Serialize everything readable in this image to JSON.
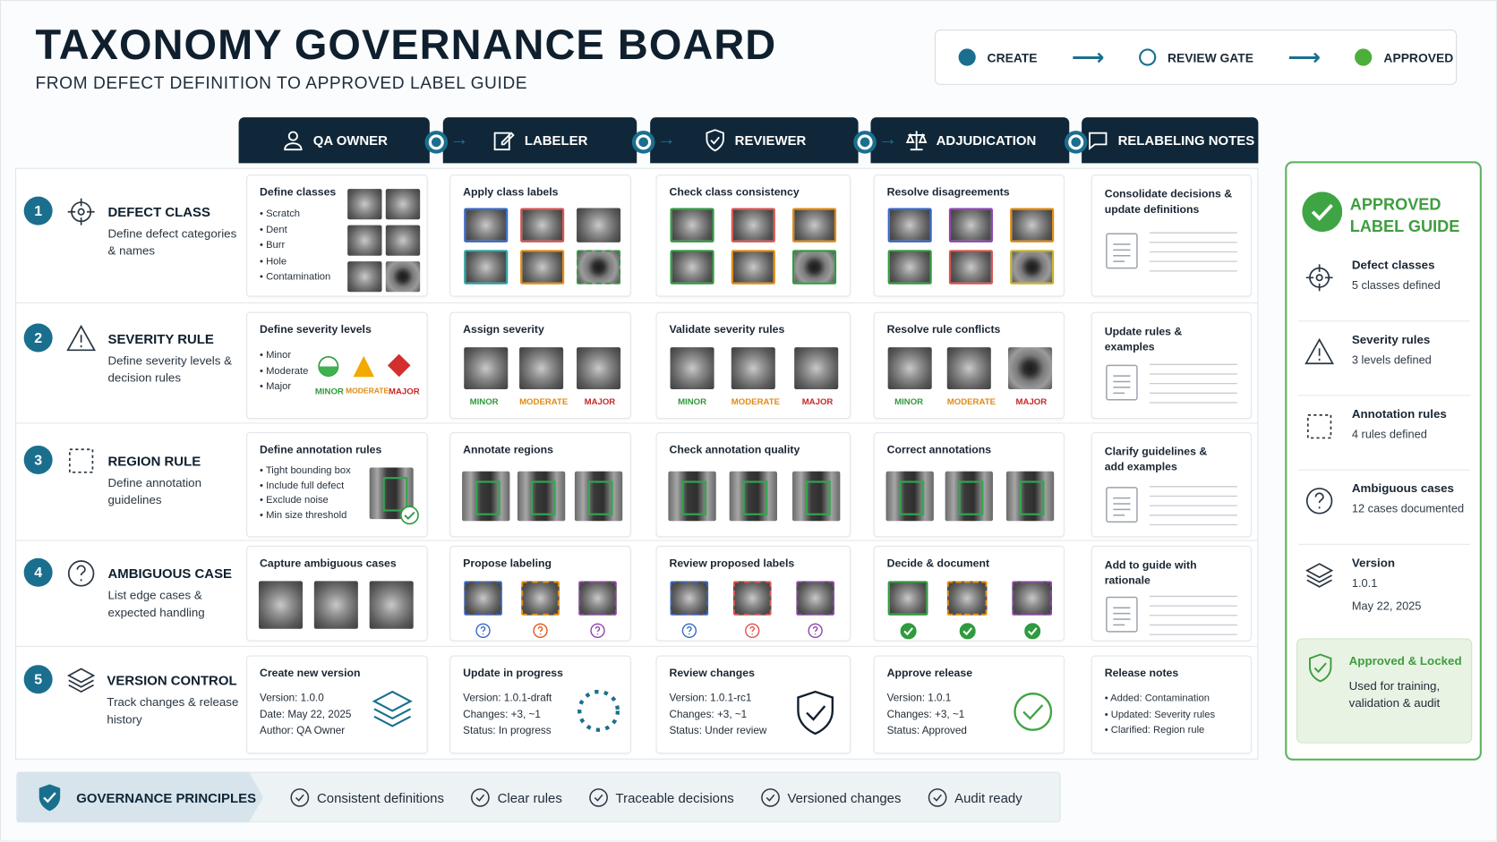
{
  "header": {
    "title": "TAXONOMY GOVERNANCE BOARD",
    "subtitle": "FROM DEFECT DEFINITION TO APPROVED LABEL GUIDE"
  },
  "legend": {
    "items": [
      {
        "label": "CREATE",
        "color": "#1a6f8e",
        "style": "filled"
      },
      {
        "label": "REVIEW GATE",
        "color": "#1a6f8e",
        "style": "outline"
      },
      {
        "label": "APPROVED",
        "color": "#4caf3a",
        "style": "filled"
      }
    ]
  },
  "columns": [
    {
      "label": "QA OWNER",
      "icon": "user-icon"
    },
    {
      "label": "LABELER",
      "icon": "edit-icon"
    },
    {
      "label": "REVIEWER",
      "icon": "shield-check-icon"
    },
    {
      "label": "ADJUDICATION",
      "icon": "scales-icon"
    },
    {
      "label": "RELABELING NOTES",
      "icon": "chat-icon"
    }
  ],
  "rows": [
    {
      "num": "1",
      "title": "DEFECT CLASS",
      "desc": "Define defect categories & names",
      "icon": "crosshair-icon",
      "cells": [
        {
          "title": "Define classes",
          "list": [
            "Scratch",
            "Dent",
            "Burr",
            "Hole",
            "Contamination"
          ]
        },
        {
          "title": "Apply class labels"
        },
        {
          "title": "Check class consistency"
        },
        {
          "title": "Resolve disagreements"
        },
        {
          "title": "Consolidate decisions & update definitions"
        }
      ]
    },
    {
      "num": "2",
      "title": "SEVERITY RULE",
      "desc": "Define severity levels & decision rules",
      "icon": "warning-icon",
      "cells": [
        {
          "title": "Define severity levels",
          "list": [
            "Minor",
            "Moderate",
            "Major"
          ],
          "levels": [
            "MINOR",
            "MODERATE",
            "MAJOR"
          ]
        },
        {
          "title": "Assign severity",
          "levels": [
            "MINOR",
            "MODERATE",
            "MAJOR"
          ]
        },
        {
          "title": "Validate severity rules",
          "levels": [
            "MINOR",
            "MODERATE",
            "MAJOR"
          ]
        },
        {
          "title": "Resolve rule conflicts",
          "levels": [
            "MINOR",
            "MODERATE",
            "MAJOR"
          ]
        },
        {
          "title": "Update rules & examples"
        }
      ]
    },
    {
      "num": "3",
      "title": "REGION RULE",
      "desc": "Define annotation guidelines",
      "icon": "dashed-box-icon",
      "cells": [
        {
          "title": "Define annotation rules",
          "list": [
            "Tight bounding box",
            "Include full defect",
            "Exclude noise",
            "Min size threshold"
          ]
        },
        {
          "title": "Annotate regions"
        },
        {
          "title": "Check annotation quality"
        },
        {
          "title": "Correct annotations"
        },
        {
          "title": "Clarify guidelines & add examples"
        }
      ]
    },
    {
      "num": "4",
      "title": "AMBIGUOUS CASE",
      "desc": "List edge cases & expected handling",
      "icon": "question-icon",
      "cells": [
        {
          "title": "Capture ambiguous cases"
        },
        {
          "title": "Propose labeling"
        },
        {
          "title": "Review proposed labels"
        },
        {
          "title": "Decide & document"
        },
        {
          "title": "Add to guide with rationale"
        }
      ]
    },
    {
      "num": "5",
      "title": "VERSION CONTROL",
      "desc": "Track changes & release history",
      "icon": "layers-icon",
      "cells": [
        {
          "title": "Create new version",
          "lines": [
            "Version:  1.0.0",
            "Date: May 22, 2025",
            "Author: QA Owner"
          ]
        },
        {
          "title": "Update in progress",
          "lines": [
            "Version:  1.0.1-draft",
            "Changes: +3, ~1",
            "Status: In progress"
          ]
        },
        {
          "title": "Review changes",
          "lines": [
            "Version:  1.0.1-rc1",
            "Changes: +3, ~1",
            "Status: Under review"
          ]
        },
        {
          "title": "Approve release",
          "lines": [
            "Version:  1.0.1",
            "Changes: +3, ~1",
            "Status: Approved"
          ]
        },
        {
          "title": "Release notes",
          "list": [
            "Added: Contamination",
            "Updated: Severity rules",
            "Clarified: Region rule"
          ]
        }
      ]
    }
  ],
  "approved": {
    "title_line1": "APPROVED",
    "title_line2": "LABEL GUIDE",
    "items": [
      {
        "title": "Defect classes",
        "desc": "5 classes defined",
        "icon": "crosshair-icon"
      },
      {
        "title": "Severity rules",
        "desc": "3 levels defined",
        "icon": "warning-icon"
      },
      {
        "title": "Annotation rules",
        "desc": "4 rules defined",
        "icon": "dashed-box-icon"
      },
      {
        "title": "Ambiguous cases",
        "desc": "12 cases documented",
        "icon": "question-icon"
      },
      {
        "title": "Version",
        "desc": "1.0.1",
        "desc2": "May 22, 2025",
        "icon": "layers-icon"
      }
    ],
    "locked_title": "Approved & Locked",
    "locked_desc": "Used for training, validation & audit"
  },
  "principles": {
    "head": "GOVERNANCE PRINCIPLES",
    "items": [
      "Consistent definitions",
      "Clear rules",
      "Traceable decisions",
      "Versioned changes",
      "Audit ready"
    ]
  },
  "colors": {
    "teal": "#1a6f8e",
    "navy": "#0f2738",
    "green": "#4caf3a",
    "orange": "#e28a10",
    "red": "#c62828",
    "purple": "#8e44ad",
    "blue": "#3566c8"
  }
}
